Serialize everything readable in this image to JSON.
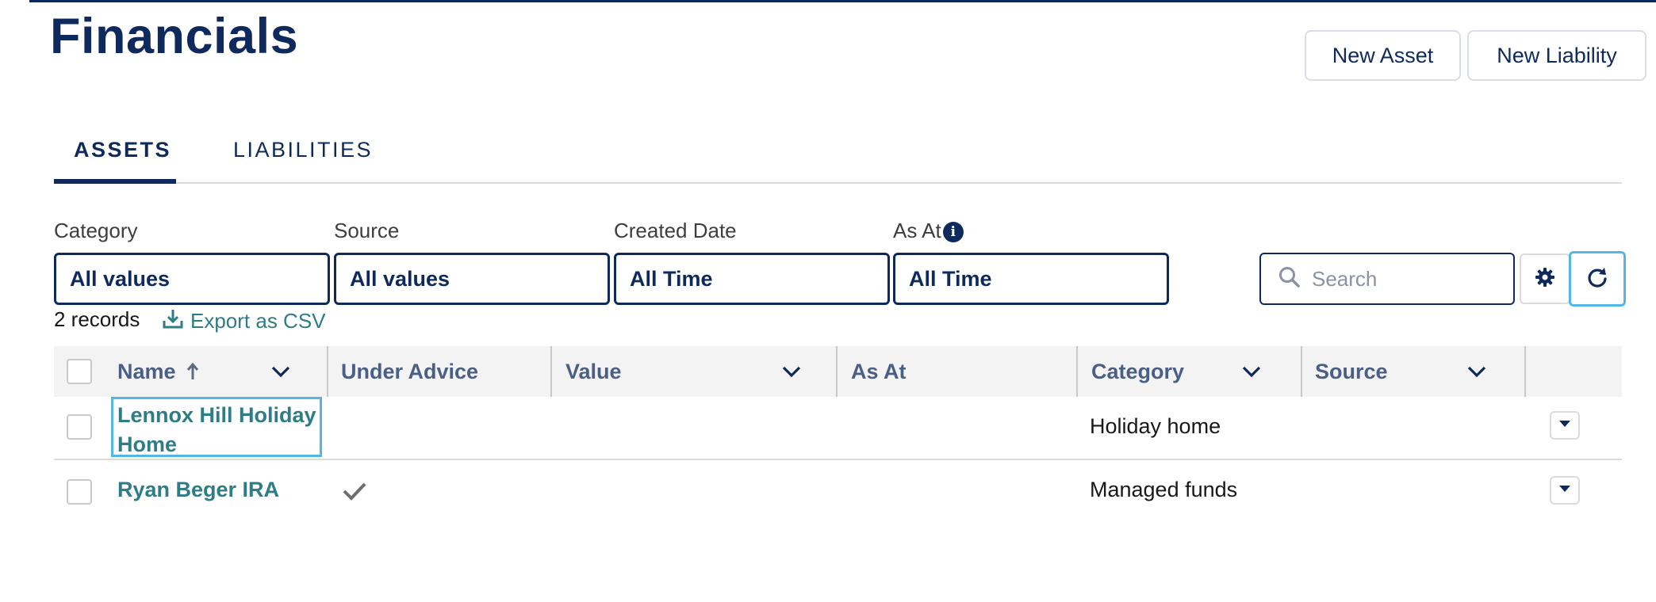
{
  "header": {
    "title": "Financials",
    "new_asset_label": "New Asset",
    "new_liability_label": "New Liability"
  },
  "tabs": [
    {
      "label": "ASSETS",
      "active": true
    },
    {
      "label": "LIABILITIES",
      "active": false
    }
  ],
  "filters": {
    "category": {
      "label": "Category",
      "value": "All values"
    },
    "source": {
      "label": "Source",
      "value": "All values"
    },
    "created_date": {
      "label": "Created Date",
      "value": "All Time"
    },
    "as_at": {
      "label": "As At",
      "value": "All Time"
    }
  },
  "search": {
    "placeholder": "Search",
    "value": ""
  },
  "toolbar": {
    "records_text": "2 records",
    "export_label": "Export as CSV"
  },
  "table": {
    "columns": [
      {
        "label": "Name",
        "sort": "ascending"
      },
      {
        "label": "Under Advice"
      },
      {
        "label": "Value"
      },
      {
        "label": "As At"
      },
      {
        "label": "Category"
      },
      {
        "label": "Source"
      }
    ],
    "rows": [
      {
        "name_line1": "Lennox Hill Holiday",
        "name_line2": "Home",
        "under_advice": false,
        "value": "",
        "as_at": "",
        "category": "Holiday home",
        "source": ""
      },
      {
        "name_line1": "Ryan Beger IRA",
        "name_line2": "",
        "under_advice": true,
        "value": "",
        "as_at": "",
        "category": "Managed funds",
        "source": ""
      }
    ]
  },
  "icons": [
    "search-icon",
    "gear-icon",
    "refresh-icon",
    "download-icon",
    "info-icon",
    "chevron-down-icon",
    "arrow-up-icon",
    "check-icon"
  ],
  "colors": {
    "brand_navy": "#0e2a5c",
    "link_teal": "#2e7c86",
    "focus_blue": "#53b7e5",
    "header_text": "#4a5f86"
  }
}
